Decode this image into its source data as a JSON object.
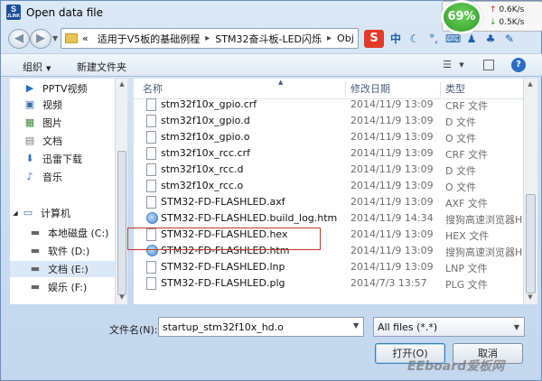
{
  "window": {
    "title": "Open data file",
    "icon_text": "S",
    "icon_subtext": "JLINK"
  },
  "speed_widget": {
    "percent": "69%",
    "up": "0.6K/s",
    "down": "0.5K/s"
  },
  "address_bar": {
    "breadcrumbs": [
      "«",
      "适用于V5板的基础例程",
      "STM32奋斗板-LED闪烁",
      "Obj"
    ]
  },
  "tray": {
    "sogou": "S",
    "items": [
      "中",
      "moon-icon",
      "comma-icon",
      "keyboard-icon",
      "user-icon",
      "shirt-icon",
      "wrench-icon"
    ]
  },
  "command_bar": {
    "organize": "组织",
    "new_folder": "新建文件夹"
  },
  "nav_pane": {
    "items": [
      {
        "label": "PPTV视频",
        "icon": "pptv-icon"
      },
      {
        "label": "视频",
        "icon": "video-icon"
      },
      {
        "label": "图片",
        "icon": "pictures-icon"
      },
      {
        "label": "文档",
        "icon": "documents-icon"
      },
      {
        "label": "迅雷下载",
        "icon": "thunder-download-icon"
      },
      {
        "label": "音乐",
        "icon": "music-icon"
      },
      {
        "label": "计算机",
        "icon": "computer-icon"
      },
      {
        "label": "本地磁盘 (C:)",
        "icon": "drive-icon"
      },
      {
        "label": "软件 (D:)",
        "icon": "drive-icon"
      },
      {
        "label": "文档 (E:)",
        "icon": "drive-icon"
      },
      {
        "label": "娱乐 (F:)",
        "icon": "drive-icon"
      }
    ]
  },
  "file_list": {
    "columns": {
      "name": "名称",
      "date": "修改日期",
      "type": "类型"
    },
    "rows": [
      {
        "name": "stm32f10x_gpio.crf",
        "date": "2014/11/9 13:09",
        "type": "CRF 文件",
        "icon": "file-icon"
      },
      {
        "name": "stm32f10x_gpio.d",
        "date": "2014/11/9 13:09",
        "type": "D 文件",
        "icon": "file-icon"
      },
      {
        "name": "stm32f10x_gpio.o",
        "date": "2014/11/9 13:09",
        "type": "O 文件",
        "icon": "file-icon"
      },
      {
        "name": "stm32f10x_rcc.crf",
        "date": "2014/11/9 13:09",
        "type": "CRF 文件",
        "icon": "file-icon"
      },
      {
        "name": "stm32f10x_rcc.d",
        "date": "2014/11/9 13:09",
        "type": "D 文件",
        "icon": "file-icon"
      },
      {
        "name": "stm32f10x_rcc.o",
        "date": "2014/11/9 13:09",
        "type": "O 文件",
        "icon": "file-icon"
      },
      {
        "name": "STM32-FD-FLASHLED.axf",
        "date": "2014/11/9 13:09",
        "type": "AXF 文件",
        "icon": "file-icon"
      },
      {
        "name": "STM32-FD-FLASHLED.build_log.htm",
        "date": "2014/11/9 14:34",
        "type": "搜狗高速浏览器H...",
        "icon": "web-icon"
      },
      {
        "name": "STM32-FD-FLASHLED.hex",
        "date": "2014/11/9 13:09",
        "type": "HEX 文件",
        "icon": "file-icon"
      },
      {
        "name": "STM32-FD-FLASHLED.htm",
        "date": "2014/11/9 13:09",
        "type": "搜狗高速浏览器H...",
        "icon": "web-icon"
      },
      {
        "name": "STM32-FD-FLASHLED.lnp",
        "date": "2014/11/9 13:09",
        "type": "LNP 文件",
        "icon": "file-icon"
      },
      {
        "name": "STM32-FD-FLASHLED.plg",
        "date": "2014/7/3 13:57",
        "type": "PLG 文件",
        "icon": "file-icon"
      }
    ]
  },
  "bottom": {
    "filename_label": "文件名(N):",
    "filename_value": "startup_stm32f10x_hd.o",
    "filter_value": "All files (*.*)",
    "open_button": "打开(O)",
    "cancel_button": "取消"
  },
  "watermark": "EEboard爱板网",
  "colors": {
    "accent": "#3c7fb1",
    "highlight_box": "#c0392b",
    "speed_green": "#2f9a26"
  }
}
